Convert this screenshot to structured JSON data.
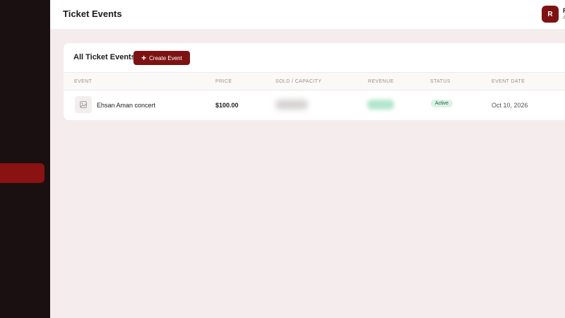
{
  "header": {
    "title": "Ticket Events",
    "user_initial": "R",
    "user_name_partial": "F",
    "user_sub_partial": "A"
  },
  "card": {
    "title": "All Ticket Events",
    "create_label": "Create Event"
  },
  "table": {
    "columns": [
      "EVENT",
      "PRICE",
      "SOLD / CAPACITY",
      "REVENUE",
      "STATUS",
      "EVENT DATE"
    ],
    "rows": [
      {
        "event": "Ehsan Aman concert",
        "price": "$100.00",
        "status": "Active",
        "date": "Oct 10, 2026"
      }
    ]
  },
  "colors": {
    "brand": "#7e1212",
    "sidebar": "#1a1012",
    "background": "#f5eded",
    "status_active_bg": "#dcf3e6"
  },
  "icons": {
    "create": "plus-icon",
    "event_thumbnail": "image-placeholder-icon"
  }
}
